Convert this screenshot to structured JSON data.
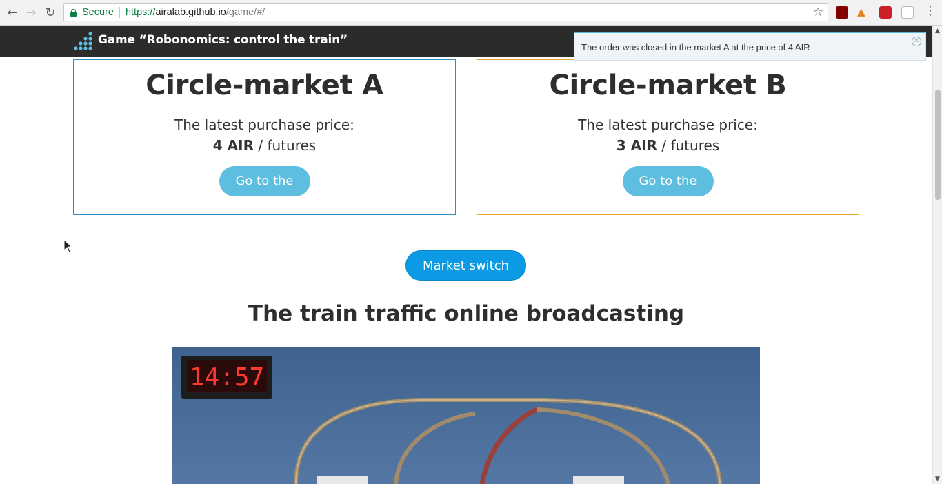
{
  "browser": {
    "secure_label": "Secure",
    "url_scheme": "https://",
    "url_host": "airalab.github.io",
    "url_path": "/game/#/"
  },
  "header": {
    "title": "Game “Robonomics: control the train”"
  },
  "notification": {
    "text": "The order was closed in the market A at the price of 4 AIR"
  },
  "markets": [
    {
      "title": "Circle-market A",
      "price_label": "The latest purchase price:",
      "price_value": "4 AIR",
      "price_unit": " / futures",
      "button_label": "Go to the",
      "border_color": "#2b8fc4"
    },
    {
      "title": "Circle-market B",
      "price_label": "The latest purchase price:",
      "price_value": "3 AIR",
      "price_unit": " / futures",
      "button_label": "Go to the",
      "border_color": "#e8a52a"
    }
  ],
  "switch_button": {
    "label": "Market switch"
  },
  "broadcast": {
    "title": "The train traffic online broadcasting",
    "clock_text": "14:57"
  },
  "colors": {
    "header_bg": "#2b2b2b",
    "button_light": "#5ebedf",
    "button_primary": "#0b9ae3"
  }
}
